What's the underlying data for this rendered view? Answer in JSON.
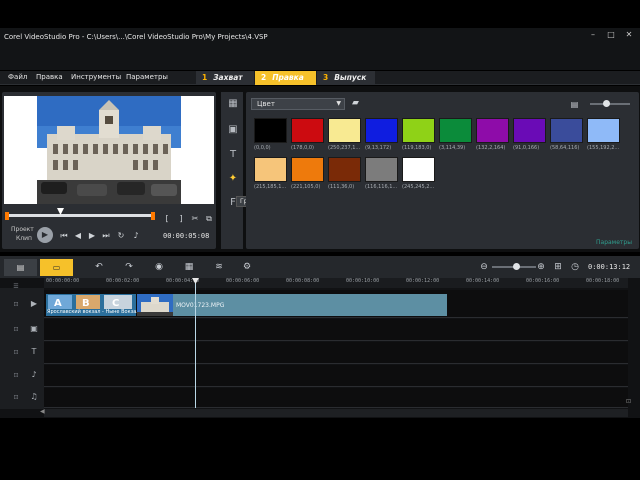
{
  "app": {
    "title": "Corel VideoStudio Pro - C:\\Users\\...\\Corel VideoStudio Pro\\My Projects\\4.VSP",
    "window_controls": [
      "–",
      "□",
      "✕"
    ]
  },
  "menu": {
    "items": [
      "Файл",
      "Правка",
      "Инструменты",
      "Параметры"
    ]
  },
  "steps": [
    {
      "num": "1",
      "label": "Захват",
      "active": false
    },
    {
      "num": "2",
      "label": "Правка",
      "active": true
    },
    {
      "num": "3",
      "label": "Выпуск",
      "active": false
    }
  ],
  "preview": {
    "mode_project": "Проект",
    "mode_clip": "Клип",
    "timecode": "00:00:05:08"
  },
  "library": {
    "category": "Цвет",
    "tooltip": "Графика",
    "options_label": "Параметры",
    "swatches_row1": [
      {
        "color": "#000000",
        "label": "(0,0,0)"
      },
      {
        "color": "#cc0b10",
        "label": "(178,0,0)"
      },
      {
        "color": "#f8ea92",
        "label": "(250,237,1..."
      },
      {
        "color": "#0f1de0",
        "label": "(9,13,172)"
      },
      {
        "color": "#8fd217",
        "label": "(119,183,0)"
      },
      {
        "color": "#0b8b3a",
        "label": "(3,114,39)"
      },
      {
        "color": "#8e0ca9",
        "label": "(132,2,164)"
      },
      {
        "color": "#6a0bb6",
        "label": "(91,0,166)"
      },
      {
        "color": "#3a4c9b",
        "label": "(58,64,116)"
      },
      {
        "color": "#8fbaf8",
        "label": "(155,192,2..."
      }
    ],
    "swatches_row2": [
      {
        "color": "#f6c57a",
        "label": "(215,185,1..."
      },
      {
        "color": "#ee7a0c",
        "label": "(221,105,0)"
      },
      {
        "color": "#7a2a07",
        "label": "(111,36,0)"
      },
      {
        "color": "#7c7c7c",
        "label": "(116,116,1..."
      },
      {
        "color": "#ffffff",
        "label": "(245,245,2..."
      }
    ]
  },
  "timeline": {
    "project_timecode": "0:00:13:12",
    "ruler": [
      "00:00:00:00",
      "00:00:02:00",
      "00:00:04:00",
      "00:00:06:00",
      "00:00:08:00",
      "00:00:10:00",
      "00:00:12:00",
      "00:00:14:00",
      "00:00:16:00",
      "00:00:18:00"
    ],
    "video_clip": "MOV01723.MPG",
    "title_clip": "Ярославский вокзал - Ныне Вокзалы С Малолана"
  },
  "colors": {
    "accent": "#f6c12a",
    "panel": "#2b2e33",
    "clip_video": "#5d8fa3",
    "trim": "#ff7a00"
  }
}
